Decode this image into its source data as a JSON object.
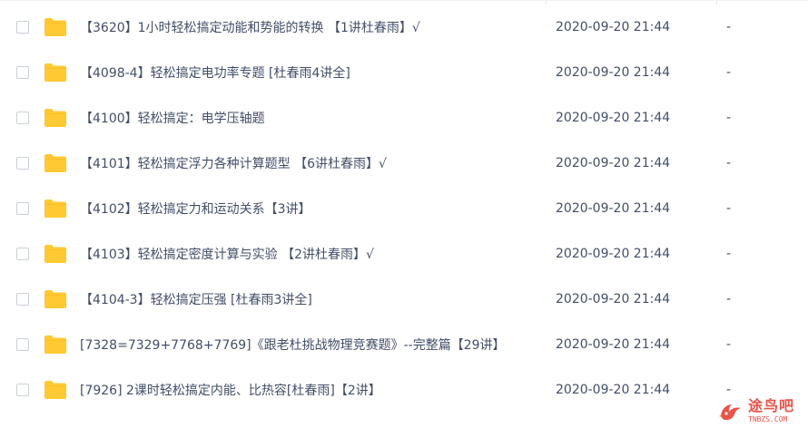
{
  "files": [
    {
      "name": "【3620】1小时轻松搞定动能和势能的转换 【1讲杜春雨】√",
      "modified": "2020-09-20 21:44",
      "size": "-"
    },
    {
      "name": "【4098-4】轻松搞定电功率专题 [杜春雨4讲全]",
      "modified": "2020-09-20 21:44",
      "size": "-"
    },
    {
      "name": "【4100】轻松搞定：电学压轴题",
      "modified": "2020-09-20 21:44",
      "size": "-"
    },
    {
      "name": "【4101】轻松搞定浮力各种计算题型 【6讲杜春雨】√",
      "modified": "2020-09-20 21:44",
      "size": "-"
    },
    {
      "name": "【4102】轻松搞定力和运动关系【3讲】",
      "modified": "2020-09-20 21:44",
      "size": "-"
    },
    {
      "name": "【4103】轻松搞定密度计算与实验 【2讲杜春雨】√",
      "modified": "2020-09-20 21:44",
      "size": "-"
    },
    {
      "name": "【4104-3】轻松搞定压强 [杜春雨3讲全]",
      "modified": "2020-09-20 21:44",
      "size": "-"
    },
    {
      "name": "[7328=7329+7768+7769]《跟老杜挑战物理竞赛题》--完整篇【29讲】",
      "modified": "2020-09-20 21:44",
      "size": "-"
    },
    {
      "name": "[7926] 2课时轻松搞定内能、比热容[杜春雨]【2讲】",
      "modified": "2020-09-20 21:44",
      "size": "-"
    }
  ],
  "watermark": {
    "title": "途鸟吧",
    "subtitle": "TNBZS.COM"
  },
  "colors": {
    "folder": "#ffc933",
    "folder_dark": "#f5b71f",
    "text": "#424e67",
    "checkbox_border": "#c9cfd9",
    "watermark": "#e8534a"
  },
  "icons": {
    "row_icon": "folder-icon",
    "watermark_icon": "bird-logo-icon"
  }
}
